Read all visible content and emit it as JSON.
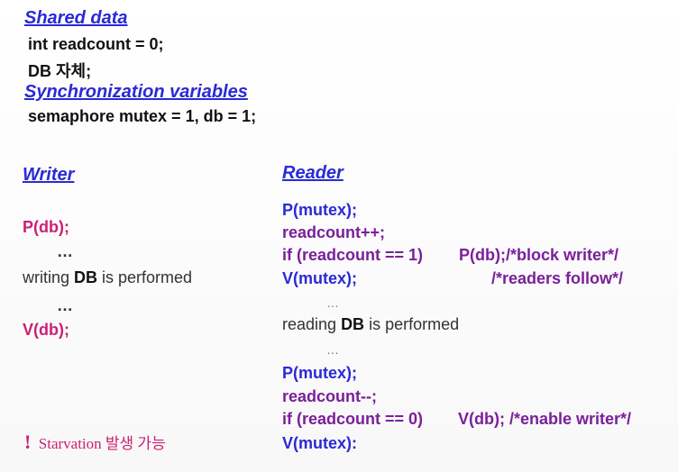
{
  "shared": {
    "heading": "Shared data",
    "line1": "int readcount = 0;",
    "line2": "DB 자체;"
  },
  "sync": {
    "heading": "Synchronization variables",
    "line1": "semaphore mutex = 1, db = 1;"
  },
  "writer": {
    "heading": "Writer",
    "p_db": "P(db);",
    "ellipsis1": "…",
    "writing_pre": "writing ",
    "writing_db": "DB",
    "writing_post": " is performed",
    "ellipsis2": "…",
    "v_db": "V(db);"
  },
  "reader": {
    "heading": "Reader",
    "p_mutex1": "P(mutex);",
    "readcount_inc": "readcount++;",
    "if1_cond": "if (readcount == 1)",
    "if1_action": "P(db);/*block writer*/",
    "v_mutex1": "V(mutex);",
    "comment_follow": "/*readers follow*/",
    "ellipsis1": "…",
    "reading_pre": "reading ",
    "reading_db": "DB",
    "reading_post": " is performed",
    "ellipsis2": "…",
    "p_mutex2": "P(mutex);",
    "readcount_dec": "readcount--;",
    "if2_cond": "if (readcount == 0)",
    "if2_action": "V(db); /*enable writer*/",
    "v_mutex2": "V(mutex):"
  },
  "note": {
    "mark": "!",
    "text": "Starvation 발생 가능"
  },
  "colors": {
    "heading": "#2a2ad6",
    "magenta": "#cc1f73",
    "purple": "#7a1f9a",
    "text": "#111111"
  }
}
